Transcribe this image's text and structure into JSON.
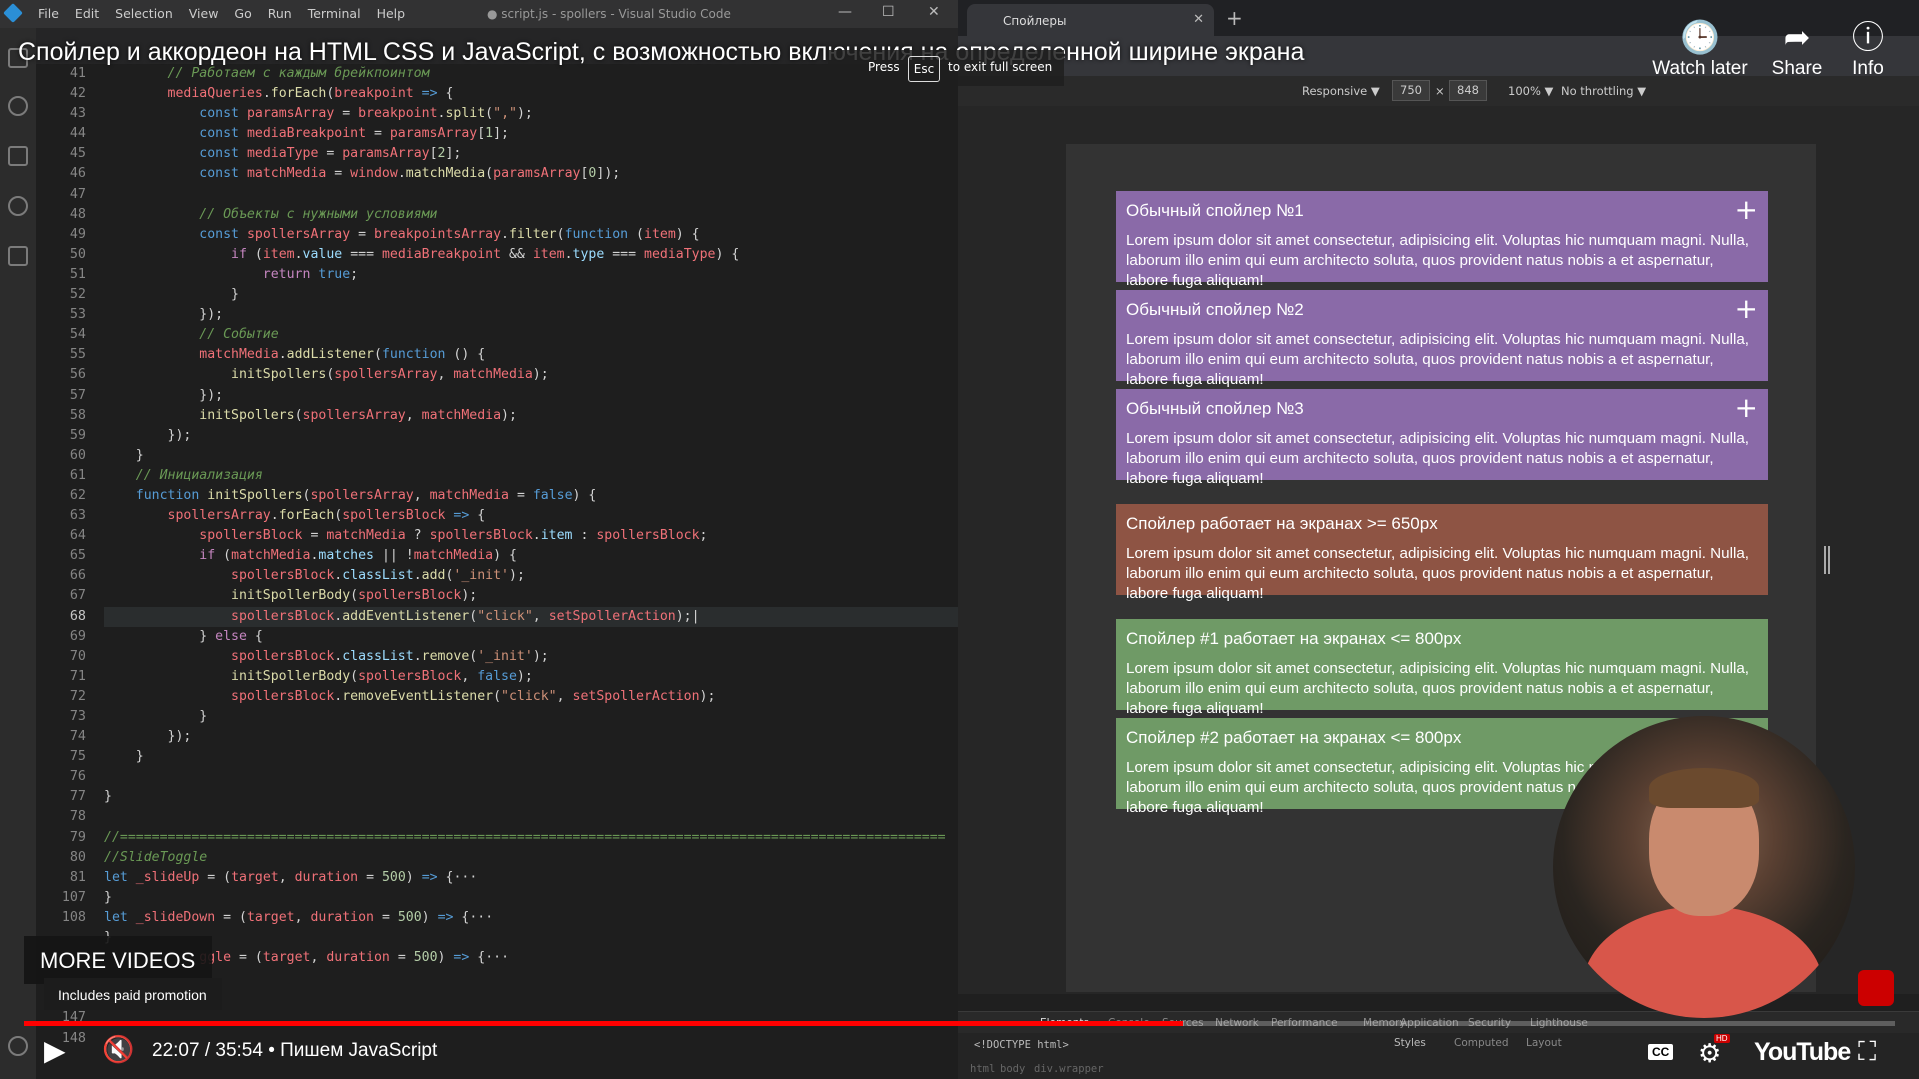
{
  "video": {
    "title": "Спойлер и аккордеон на HTML CSS и JavaScript, с возможностью включения на определенной ширине экрана",
    "esc_press": "Press",
    "esc_key": "Esc",
    "esc_suffix": "to exit full screen",
    "watch_later": "Watch later",
    "share": "Share",
    "info": "Info",
    "more_videos": "MORE VIDEOS",
    "paid_promotion": "Includes paid promotion",
    "time": "22:07 / 35:54 • Пишем JavaScript",
    "progress": 0.6195,
    "youtube_label": "YouTube",
    "hd_badge": "HD",
    "cc_label": "CC"
  },
  "vscode": {
    "menu": [
      "File",
      "Edit",
      "Selection",
      "View",
      "Go",
      "Run",
      "Terminal",
      "Help"
    ],
    "window_title": "● script.js - spollers - Visual Studio Code",
    "line_numbers": [
      "41",
      "42",
      "43",
      "44",
      "45",
      "46",
      "47",
      "48",
      "49",
      "50",
      "51",
      "52",
      "53",
      "54",
      "55",
      "56",
      "57",
      "58",
      "59",
      "60",
      "61",
      "62",
      "63",
      "64",
      "65",
      "66",
      "67",
      "68",
      "69",
      "70",
      "71",
      "72",
      "73",
      "74",
      "75",
      "76",
      "77",
      "78",
      "79",
      "80",
      "81",
      "107",
      "108",
      "",
      "",
      "",
      "146",
      "147",
      "148"
    ],
    "active_line": "68"
  },
  "browser": {
    "tab_title": "Спойлеры",
    "responsive": "Responsive ▼",
    "width": "750",
    "height": "848",
    "zoom": "100% ▼",
    "throttling": "No throttling ▼",
    "colors": {
      "purple": "#8a6aa8",
      "brown": "#8e5444",
      "green": "#6f9a66"
    },
    "spoilers": [
      {
        "title": "Обычный спойлер №1",
        "body": "Lorem ipsum dolor sit amet consectetur, adipisicing elit. Voluptas hic numquam magni. Nulla, laborum illo enim qui eum architecto soluta, quos provident natus nobis a et aspernatur, labore fuga aliquam!",
        "plus": "+"
      },
      {
        "title": "Обычный спойлер №2",
        "body": "Lorem ipsum dolor sit amet consectetur, adipisicing elit. Voluptas hic numquam magni. Nulla, laborum illo enim qui eum architecto soluta, quos provident natus nobis a et aspernatur, labore fuga aliquam!",
        "plus": "+"
      },
      {
        "title": "Обычный спойлер №3",
        "body": "Lorem ipsum dolor sit amet consectetur, adipisicing elit. Voluptas hic numquam magni. Nulla, laborum illo enim qui eum architecto soluta, quos provident natus nobis a et aspernatur, labore fuga aliquam!",
        "plus": "+"
      },
      {
        "title": "Спойлер работает на экранах >= 650px",
        "body": "Lorem ipsum dolor sit amet consectetur, adipisicing elit. Voluptas hic numquam magni. Nulla, laborum illo enim qui eum architecto soluta, quos provident natus nobis a et aspernatur, labore fuga aliquam!"
      },
      {
        "title": "Спойлер #1 работает на экранах <= 800px",
        "body": "Lorem ipsum dolor sit amet consectetur, adipisicing elit. Voluptas hic numquam magni. Nulla, laborum illo enim qui eum architecto soluta, quos provident natus nobis a et aspernatur, labore fuga aliquam!"
      },
      {
        "title": "Спойлер #2 работает на экранах <= 800px",
        "body": "Lorem ipsum dolor sit amet consectetur, adipisicing elit. Voluptas hic numquam magni. Nulla, laborum illo enim qui eum architecto soluta, quos provident natus nobis a et aspernatur, labore fuga aliquam!"
      }
    ],
    "devtools_tabs": [
      "Elements",
      "Console",
      "Sources",
      "Network",
      "Performance",
      "Memory",
      "Application",
      "Security",
      "Lighthouse"
    ],
    "doctype": "<!DOCTYPE html>",
    "breadcrumb": [
      "html",
      "body",
      "div.wrapper"
    ],
    "styles_tabs": [
      "Styles",
      "Computed",
      "Layout"
    ]
  }
}
